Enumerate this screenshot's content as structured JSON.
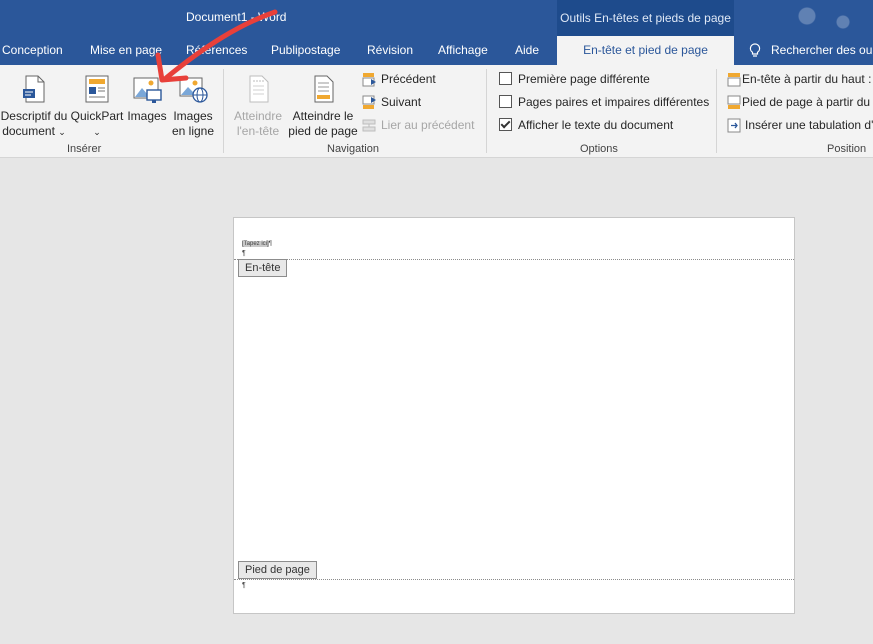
{
  "window": {
    "title": "Document1 - Word",
    "contextual_title": "Outils En-têtes et pieds de page"
  },
  "tabs": {
    "conception": "Conception",
    "mise_en_page": "Mise en page",
    "references": "Références",
    "publipostage": "Publipostage",
    "revision": "Révision",
    "affichage": "Affichage",
    "aide": "Aide",
    "entete_pied": "En-tête et pied de page",
    "rechercher": "Rechercher des ou"
  },
  "ribbon": {
    "inserer": {
      "label": "Insérer",
      "descriptif": {
        "line1": "Descriptif du",
        "line2": "document",
        "chevron": "⌄"
      },
      "quickpart": {
        "line1": "QuickPart",
        "chevron": "⌄"
      },
      "images": {
        "line1": "Images"
      },
      "images_en_ligne": {
        "line1": "Images",
        "line2": "en ligne"
      }
    },
    "navigation": {
      "label": "Navigation",
      "atteindre_entete": {
        "line1": "Atteindre",
        "line2": "l'en-tête"
      },
      "atteindre_pied": {
        "line1": "Atteindre le",
        "line2": "pied de page"
      },
      "precedent": "Précédent",
      "suivant": "Suivant",
      "lier": "Lier au précédent"
    },
    "options": {
      "label": "Options",
      "premiere_page": {
        "label": "Première page différente",
        "checked": false
      },
      "paires_impaires": {
        "label": "Pages paires et impaires différentes",
        "checked": false
      },
      "afficher_texte": {
        "label": "Afficher le texte du document",
        "checked": true
      }
    },
    "position": {
      "label": "Position",
      "entete_haut": "En-tête à partir du haut :",
      "pied_haut": "Pied de page à partir du",
      "inserer_tab": "Insérer une tabulation d'"
    }
  },
  "document": {
    "header_placeholder": "[Tapez ici]",
    "pilcrow": "¶",
    "header_tag": "En-tête",
    "footer_tag": "Pied de page"
  },
  "annotation": {
    "color": "#e8403a"
  }
}
